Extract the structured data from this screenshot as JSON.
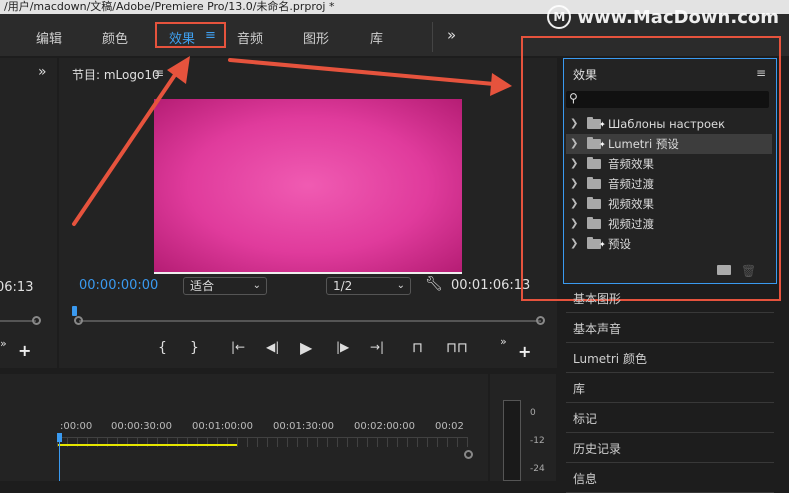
{
  "titlebar": {
    "path": "/用户/macdown/文稿/Adobe/Premiere Pro/13.0/未命名.prproj *"
  },
  "watermark": {
    "text": "www.MacDown.com",
    "logo_letter": "M"
  },
  "workspaces": {
    "tabs": [
      "编辑",
      "颜色",
      "效果",
      "音频",
      "图形",
      "库"
    ],
    "active_index": 2,
    "menu_glyph": "≡",
    "overflow_glyph": "»"
  },
  "left_panel": {
    "chevron": "»",
    "timecode": "06:13"
  },
  "program_monitor": {
    "title": "节目: mLogo10",
    "menu_glyph": "≡",
    "current_timecode": "00:00:00:00",
    "duration_timecode": "00:01:06:13",
    "fit_value": "适合",
    "resolution_value": "1/2",
    "add_glyph": "+",
    "overflow_glyph": "»"
  },
  "controls": {
    "mark_in": "{",
    "mark_out": "}",
    "go_in": "|←",
    "step_back": "◀|",
    "play": "▶",
    "step_fwd": "|▶",
    "go_out": "→|",
    "lift": "⊓",
    "extract": "⊓⊓"
  },
  "timeline": {
    "ticks": [
      ":00:00",
      "00:00:30:00",
      "00:01:00:00",
      "00:01:30:00",
      "00:02:00:00",
      "00:02"
    ]
  },
  "audio_meter": {
    "labels": [
      "0",
      "-12",
      "-24"
    ]
  },
  "effects_panel": {
    "title": "效果",
    "menu_glyph": "≡",
    "items": [
      {
        "label": "Шаблоны настроек",
        "starred": true,
        "selected": false
      },
      {
        "label": "Lumetri 预设",
        "starred": true,
        "selected": true
      },
      {
        "label": "音频效果",
        "starred": false,
        "selected": false
      },
      {
        "label": "音频过渡",
        "starred": false,
        "selected": false
      },
      {
        "label": "视频效果",
        "starred": false,
        "selected": false
      },
      {
        "label": "视频过渡",
        "starred": false,
        "selected": false
      },
      {
        "label": "预设",
        "starred": true,
        "selected": false
      }
    ]
  },
  "side_panels": [
    "基本图形",
    "基本声音",
    "Lumetri 颜色",
    "库",
    "标记",
    "历史记录",
    "信息"
  ],
  "colors": {
    "accent": "#3a9af0",
    "annotation": "#e6533d",
    "video": "#e03b9c"
  }
}
